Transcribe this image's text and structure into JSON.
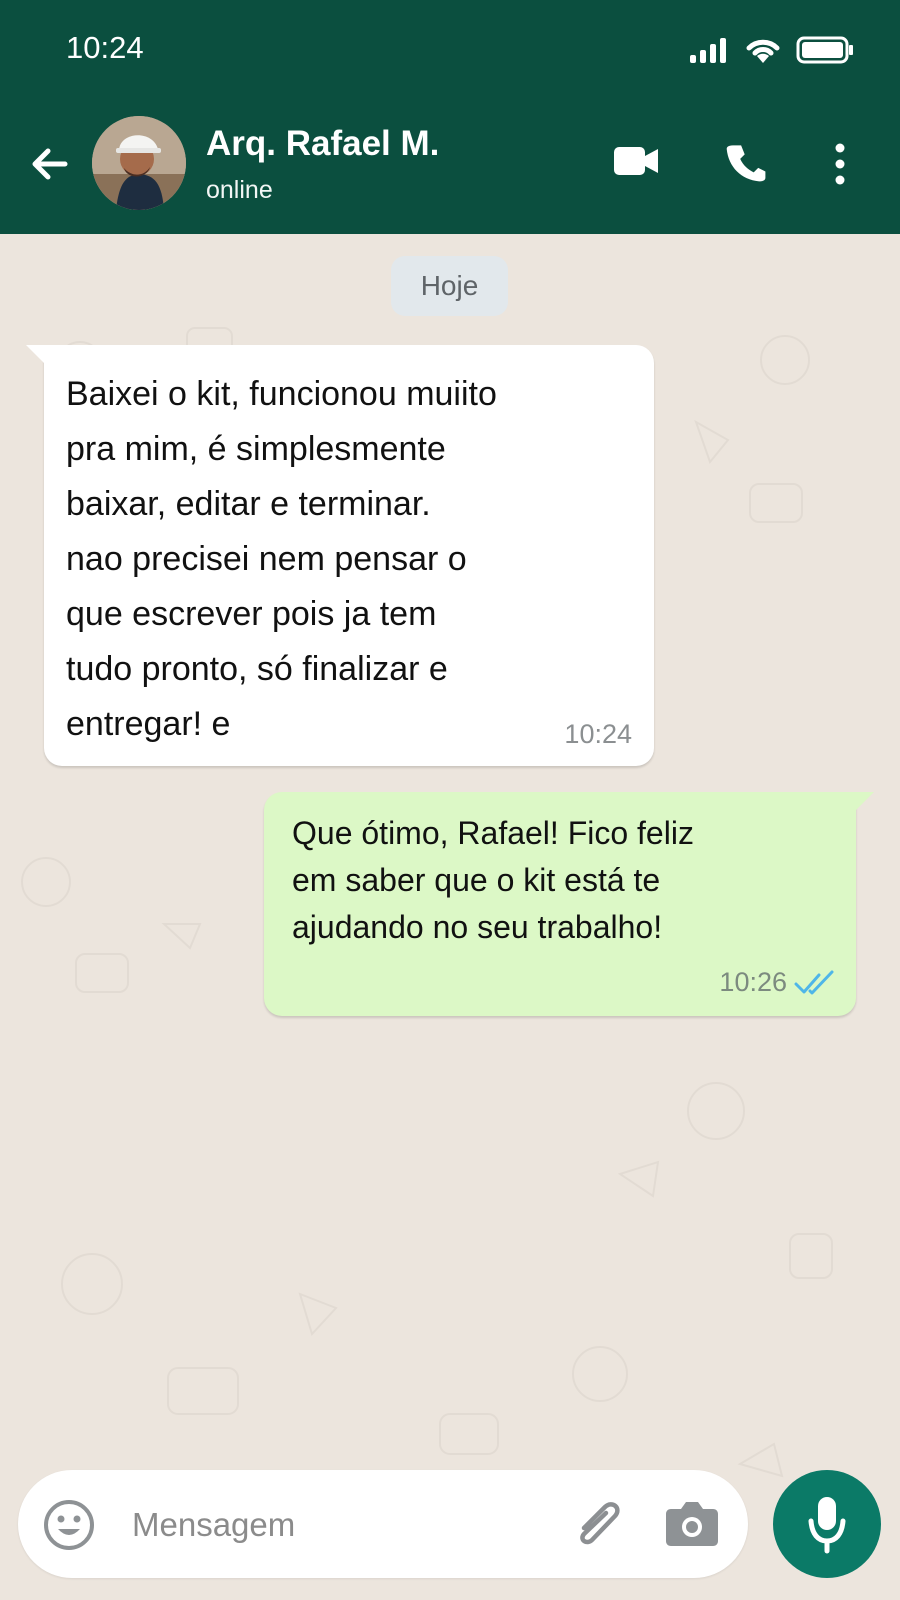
{
  "status_bar": {
    "time": "10:24"
  },
  "contact": {
    "name": "Arq. Rafael M.",
    "status": "online"
  },
  "chat": {
    "date_label": "Hoje",
    "messages": [
      {
        "text": "Baixei o kit, funcionou muiito\npra mim, é simplesmente\nbaixar, editar e terminar.\nnao precisei nem pensar o\nque escrever pois ja tem\ntudo pronto, só finalizar e\nentregar! e",
        "time": "10:24"
      },
      {
        "text": "Que ótimo, Rafael! Fico feliz\nem saber que o kit está te\najudando no seu trabalho!",
        "time": "10:26"
      }
    ]
  },
  "composer": {
    "placeholder": "Mensagem"
  },
  "colors": {
    "header": "#0B4F3F",
    "outgoing": "#DCF8C6",
    "mic": "#0B7A67"
  }
}
